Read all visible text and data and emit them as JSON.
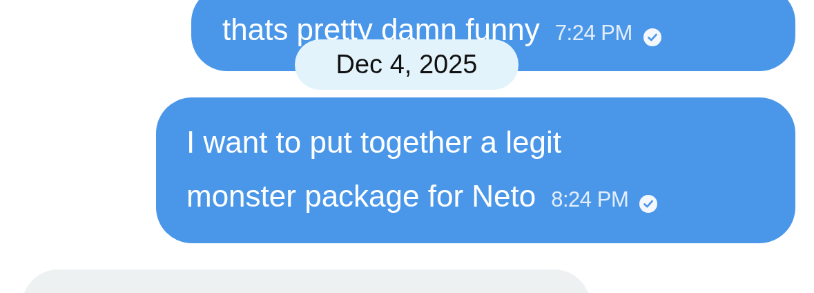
{
  "messages": [
    {
      "kind": "sent",
      "lines": [
        "thats pretty damn funny"
      ],
      "time": "7:24 PM",
      "read": true
    },
    {
      "kind": "sent",
      "lines": [
        "I want to put together a legit",
        "monster package for Neto"
      ],
      "time": "8:24 PM",
      "read": true
    },
    {
      "kind": "received"
    }
  ],
  "date_separator": {
    "text": "Dec 4, 2025"
  }
}
